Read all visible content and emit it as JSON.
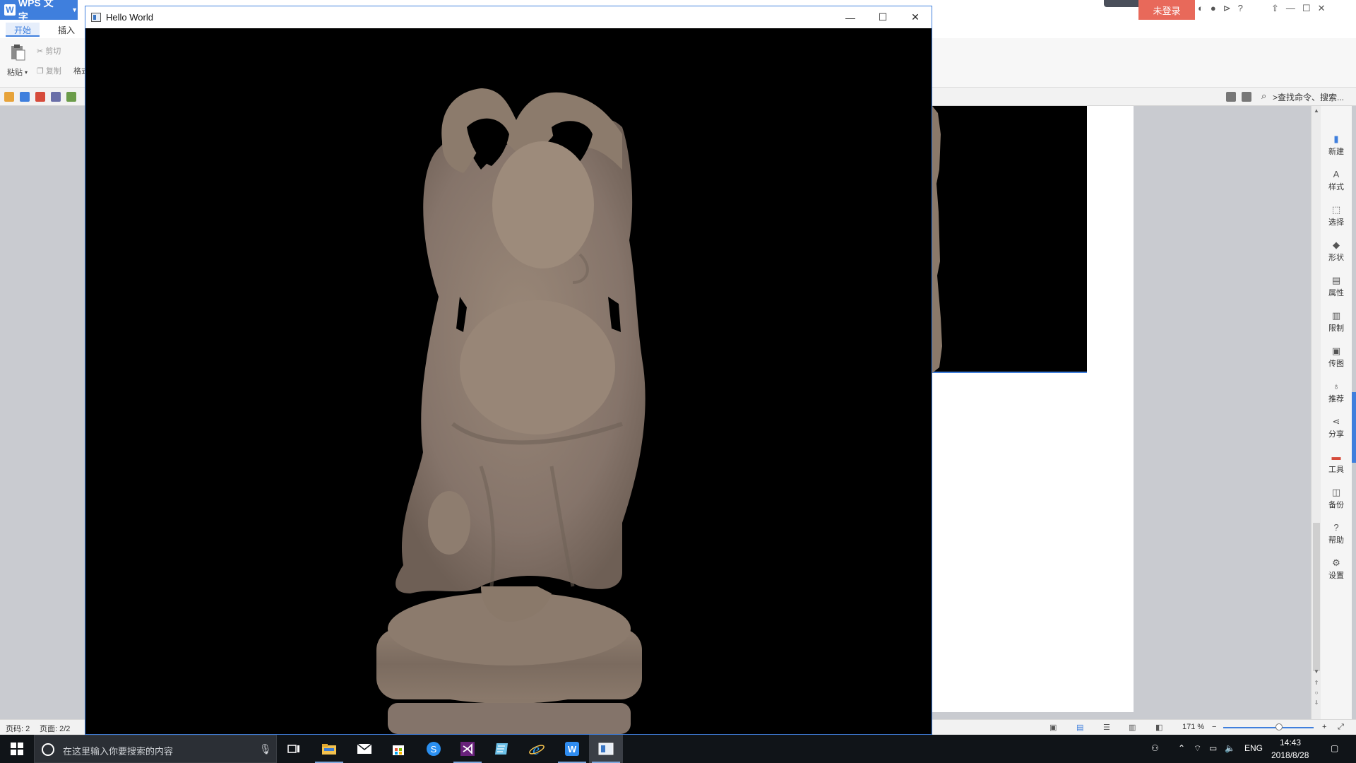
{
  "wps": {
    "app_name": "WPS 文字",
    "login_label": "未登录",
    "tabs": [
      "开始",
      "插入"
    ],
    "ribbon": {
      "paste": "粘贴",
      "cut": "剪切",
      "copy": "复制",
      "format": "格式"
    },
    "search_hint": ">查找命令、搜索...",
    "right_panel": [
      "新建",
      "样式",
      "选择",
      "形状",
      "属性",
      "限制",
      "传图",
      "推荐",
      "分享",
      "工具",
      "备份",
      "帮助",
      "设置"
    ],
    "status": {
      "page_no": "页码: 2",
      "pages": "页面: 2/2",
      "zoom": "171 %"
    },
    "colors": {
      "brand": "#3f7fdd",
      "login": "#e8695a"
    }
  },
  "hello_window": {
    "title": "Hello World",
    "minimize": "—",
    "maximize": "☐",
    "close": "✕",
    "statue_color": "#8a796a"
  },
  "taskbar": {
    "search_placeholder": "在这里输入你要搜索的内容",
    "apps": [
      "file-explorer",
      "mail",
      "store",
      "sogou",
      "visual-studio",
      "notepad",
      "ie",
      "wps",
      "hello-world"
    ],
    "tray": {
      "lang": "ENG",
      "time": "14:43",
      "date": "2018/8/28"
    }
  }
}
